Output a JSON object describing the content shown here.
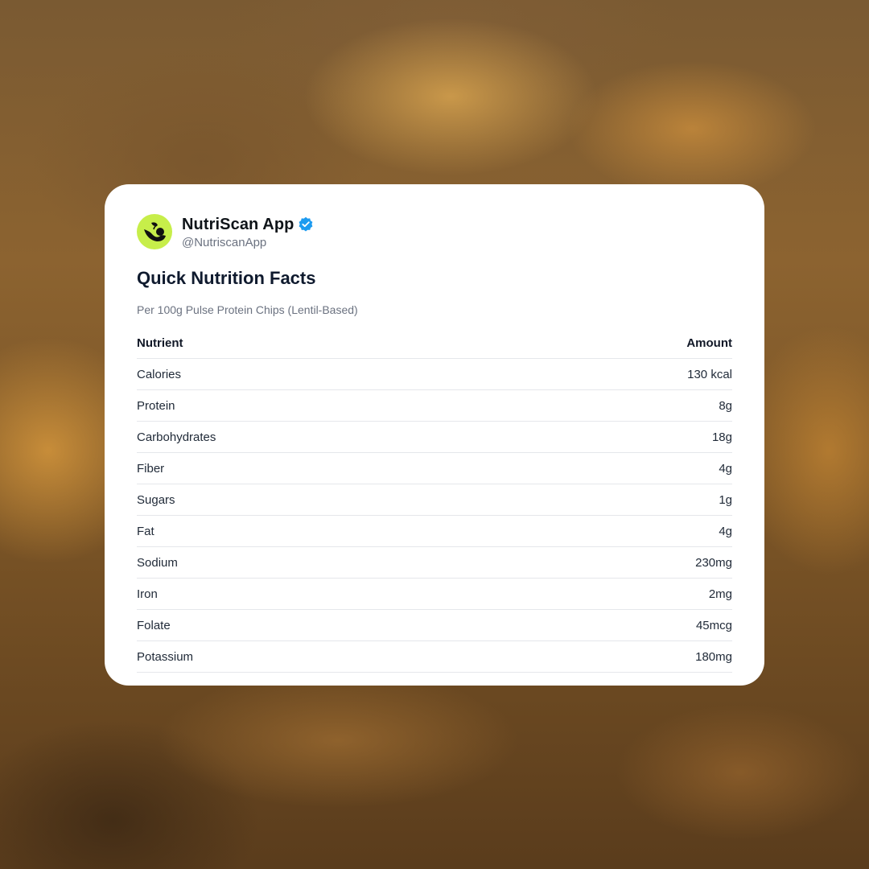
{
  "account": {
    "name": "NutriScan App",
    "handle": "@NutriscanApp",
    "verified": true,
    "avatar_icon": "leaf-logo-icon",
    "avatar_color": "#c7ee4a",
    "verified_color": "#1d9bf0"
  },
  "card": {
    "title": "Quick Nutrition Facts",
    "subtitle": "Per 100g Pulse Protein Chips (Lentil-Based)"
  },
  "table": {
    "headers": {
      "nutrient": "Nutrient",
      "amount": "Amount"
    },
    "rows": [
      {
        "nutrient": "Calories",
        "amount": "130 kcal"
      },
      {
        "nutrient": "Protein",
        "amount": "8g"
      },
      {
        "nutrient": "Carbohydrates",
        "amount": "18g"
      },
      {
        "nutrient": "Fiber",
        "amount": "4g"
      },
      {
        "nutrient": "Sugars",
        "amount": "1g"
      },
      {
        "nutrient": "Fat",
        "amount": "4g"
      },
      {
        "nutrient": "Sodium",
        "amount": "230mg"
      },
      {
        "nutrient": "Iron",
        "amount": "2mg"
      },
      {
        "nutrient": "Folate",
        "amount": "45mcg"
      },
      {
        "nutrient": "Potassium",
        "amount": "180mg"
      }
    ]
  }
}
